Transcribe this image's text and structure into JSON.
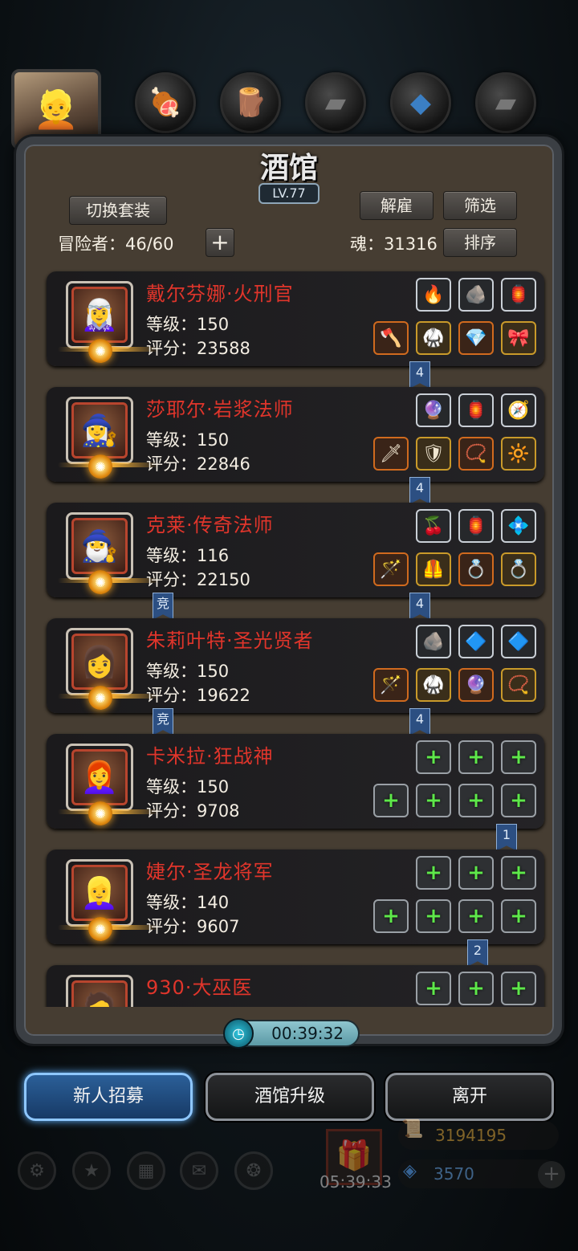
{
  "top_tabs": [
    {
      "icon": "tavern-portrait-icon",
      "glyph": "👱"
    },
    {
      "icon": "meat-icon",
      "glyph": "🍖"
    },
    {
      "icon": "lumber-icon",
      "glyph": "🪵"
    },
    {
      "icon": "iron-ingot-icon",
      "glyph": "▰"
    },
    {
      "icon": "crystal-icon",
      "glyph": "◆"
    },
    {
      "icon": "anvil-icon",
      "glyph": "▰"
    }
  ],
  "header": {
    "title": "酒馆",
    "level": "LV.77",
    "switch_outfit": "切换套装",
    "dismiss": "解雇",
    "filter": "筛选",
    "sort": "排序",
    "adventurers": "冒险者：46/60",
    "add": "+",
    "soul": "魂：31316"
  },
  "heroes": [
    {
      "name": "戴尔芬娜·火刑官",
      "level": "等级：150",
      "score": "评分：23588",
      "avatar": "🧝‍♀️",
      "frame": "#b8452e",
      "gear_top": [
        "🔥",
        "🪨",
        "🏮"
      ],
      "gear_bottom": [
        "🪓",
        "🥋",
        "💎",
        "🎀"
      ],
      "banners": [
        {
          "text": "4"
        }
      ]
    },
    {
      "name": "莎耶尔·岩浆法师",
      "level": "等级：150",
      "score": "评分：22846",
      "avatar": "🧙‍♀️",
      "frame": "#b8452e",
      "gear_top": [
        "🔮",
        "🏮",
        "🧭"
      ],
      "gear_bottom": [
        "🗡",
        "🛡",
        "📿",
        "🔆"
      ],
      "banners": [
        {
          "text": "4"
        }
      ]
    },
    {
      "name": "克莱·传奇法师",
      "level": "等级：116",
      "score": "评分：22150",
      "avatar": "🧙‍♂️",
      "frame": "#b8452e",
      "gear_top": [
        "🍒",
        "🏮",
        "💠"
      ],
      "gear_bottom": [
        "🪄",
        "🦺",
        "💍",
        "💍"
      ],
      "banners": [
        {
          "text": "竞"
        },
        {
          "text": "4"
        }
      ]
    },
    {
      "name": "朱莉叶特·圣光贤者",
      "level": "等级：150",
      "score": "评分：19622",
      "avatar": "👩",
      "frame": "#b8452e",
      "gear_top": [
        "🪨",
        "🔷",
        "🔷"
      ],
      "gear_bottom": [
        "🪄",
        "🥋",
        "🔮",
        "📿"
      ],
      "banners": [
        {
          "text": "竞"
        },
        {
          "text": "4"
        }
      ]
    },
    {
      "name": "卡米拉·狂战神",
      "level": "等级：150",
      "score": "评分：9708",
      "avatar": "👩‍🦰",
      "frame": "#b8452e",
      "gear_top": [
        "+",
        "+",
        "+"
      ],
      "gear_bottom": [
        "+",
        "+",
        "+",
        "+"
      ],
      "banners": [
        {
          "text": "1"
        }
      ]
    },
    {
      "name": "婕尔·圣龙将军",
      "level": "等级：140",
      "score": "评分：9607",
      "avatar": "👱‍♀️",
      "frame": "#b8452e",
      "gear_top": [
        "+",
        "+",
        "+"
      ],
      "gear_bottom": [
        "+",
        "+",
        "+",
        "+"
      ],
      "banners": [
        {
          "text": "2"
        }
      ]
    },
    {
      "name": "930·大巫医",
      "level": "",
      "score": "",
      "avatar": "🧔",
      "frame": "#b8452e",
      "gear_top": [
        "+",
        "+",
        "+"
      ],
      "gear_bottom": [],
      "banners": []
    }
  ],
  "timer": "00:39:32",
  "buttons": {
    "recruit": "新人招募",
    "upgrade": "酒馆升级",
    "leave": "离开"
  },
  "footer": {
    "gift_timer": "05:39:33",
    "gold": "3194195",
    "gems": "3570"
  }
}
